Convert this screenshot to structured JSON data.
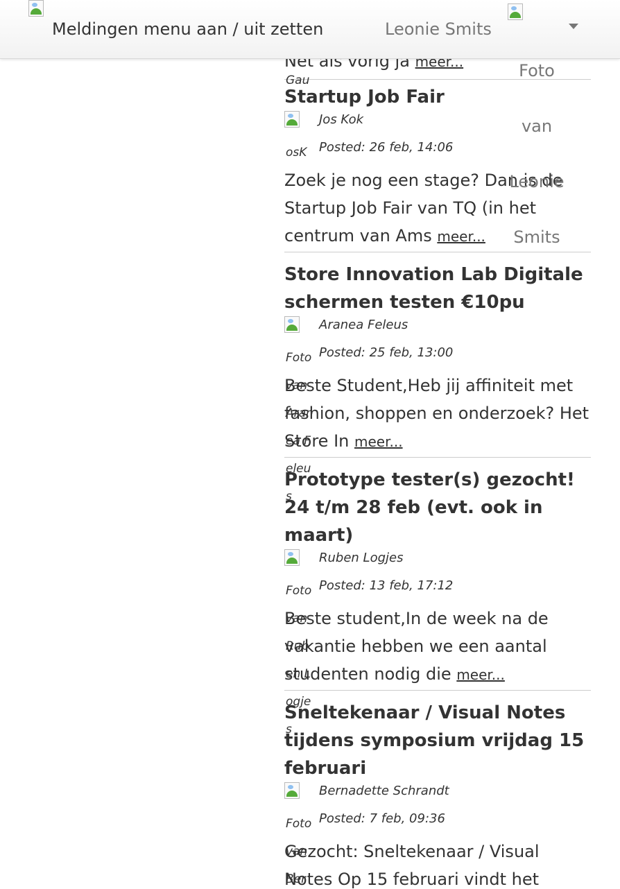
{
  "topbar": {
    "notifications_toggle": "Meldingen menu aan / uit zetten",
    "user_name": "Leonie Smits",
    "avatar_alt": "Foto van Leonie Smits"
  },
  "feed": {
    "cut_snippet": "Net als vorig ja",
    "cut_snippet_more": "meer...",
    "cut_alt": "Gau",
    "posts": [
      {
        "title": "Startup Job Fair",
        "author": "Jos Kok",
        "avatar_alt": "Foto van Jos Kok",
        "posted": "Posted: 26 feb, 14:06",
        "excerpt": "Zoek je nog een stage? Dan is de Startup Job Fair van TQ (in het centrum van Ams",
        "more": "meer..."
      },
      {
        "title": "Store Innovation Lab Digitale schermen testen €10pu",
        "author": "Aranea Feleus",
        "avatar_alt": "Foto van Aranea Feleus",
        "posted": "Posted: 25 feb, 13:00",
        "excerpt": "Beste Student,Heb jij affiniteit met fashion, shoppen en onderzoek? Het Store In",
        "more": "meer..."
      },
      {
        "title": "Prototype tester(s) gezocht! 24 t/m 28 feb (evt. ook in maart)",
        "author": "Ruben Logjes",
        "avatar_alt": "Foto van Ruben Logjes",
        "posted": "Posted: 13 feb, 17:12",
        "excerpt": "Beste student,In de week na de vakantie hebben we een aantal studenten nodig die",
        "more": "meer..."
      },
      {
        "title": "Sneltekenaar / Visual Notes tijdens symposium vrijdag 15 februari",
        "author": "Bernadette Schrandt",
        "avatar_alt": "Foto van Ber",
        "posted": "Posted: 7 feb, 09:36",
        "excerpt": "Gezocht: Sneltekenaar / Visual Notes Op 15 februari vindt het",
        "more": ""
      }
    ]
  }
}
